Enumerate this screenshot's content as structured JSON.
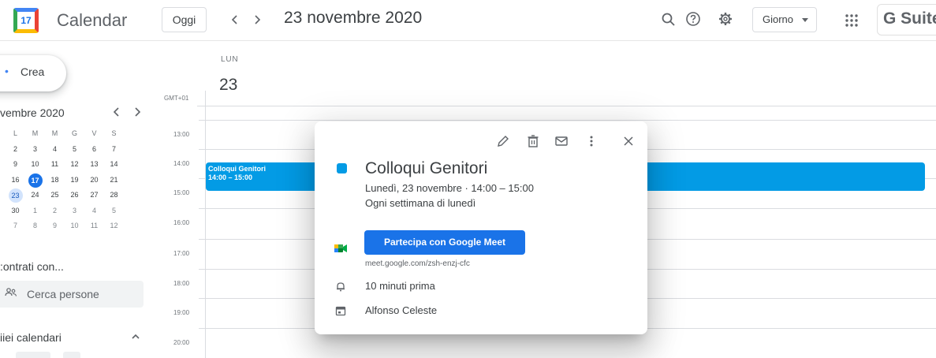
{
  "header": {
    "logo_day": "17",
    "app_title": "Calendar",
    "today_label": "Oggi",
    "date_title": "23 novembre 2020",
    "view_label": "Giorno",
    "suite_label": "G Suite",
    "icons": [
      "search-icon",
      "help-icon",
      "settings-icon",
      "apps-icon"
    ]
  },
  "sidebar": {
    "create_label": "Crea",
    "mini_month_title": "vembre 2020",
    "weekday_headers": [
      "L",
      "M",
      "M",
      "G",
      "V",
      "S"
    ],
    "weeks": [
      [
        "2",
        "3",
        "4",
        "5",
        "6",
        "7"
      ],
      [
        "9",
        "10",
        "11",
        "12",
        "13",
        "14"
      ],
      [
        "16",
        "17",
        "18",
        "19",
        "20",
        "21"
      ],
      [
        "23",
        "24",
        "25",
        "26",
        "27",
        "28"
      ],
      [
        "30",
        "1",
        "2",
        "3",
        "4",
        "5"
      ],
      [
        "7",
        "8",
        "9",
        "10",
        "11",
        "12"
      ]
    ],
    "today_day": "17",
    "selected_day": "23",
    "contacts_title": ":ontrati con...",
    "search_people_label": "Cerca persone",
    "my_calendars_title": "iiei calendari"
  },
  "day_view": {
    "weekday": "LUN",
    "day_number": "23",
    "timezone": "GMT+01",
    "hours": [
      "13:00",
      "14:00",
      "15:00",
      "16:00",
      "17:00",
      "18:00",
      "19:00",
      "20:00"
    ]
  },
  "event": {
    "title": "Colloqui Genitori",
    "time": "14:00 – 15:00",
    "color": "#039be5"
  },
  "popup": {
    "title": "Colloqui Genitori",
    "date_time": "Lunedì, 23 novembre  ·  14:00 – 15:00",
    "recurrence": "Ogni settimana di lunedì",
    "meet_button": "Partecipa con Google Meet",
    "meet_link": "meet.google.com/zsh-enzj-cfc",
    "reminder": "10 minuti prima",
    "organizer": "Alfonso Celeste",
    "actions": [
      "edit-icon",
      "delete-icon",
      "email-icon",
      "more-icon",
      "close-icon"
    ]
  },
  "colors": {
    "primary": "#1a73e8",
    "event": "#039be5",
    "border": "#dadce0"
  }
}
